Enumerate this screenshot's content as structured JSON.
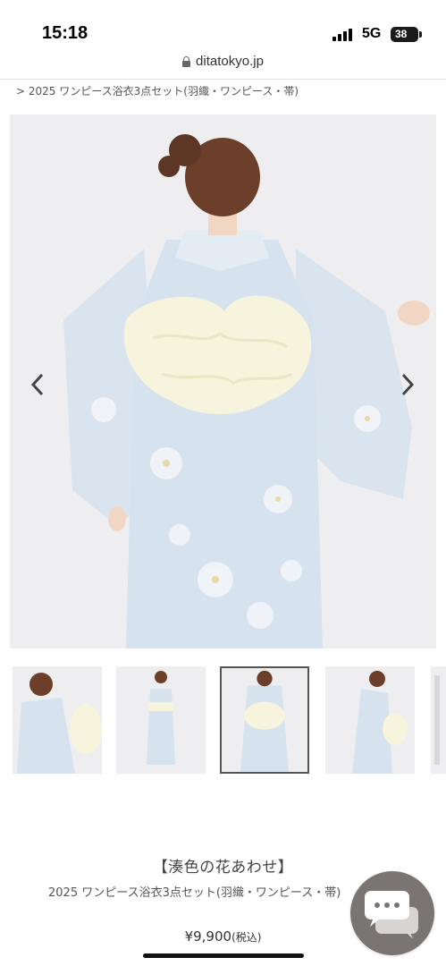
{
  "status_bar": {
    "time": "15:18",
    "network": "5G",
    "battery": "38"
  },
  "browser": {
    "url": "ditatokyo.jp",
    "lock_icon": "lock-icon"
  },
  "breadcrumb": {
    "text": "> 2025 ワンピース浴衣3点セット(羽織・ワンピース・帯)"
  },
  "gallery": {
    "prev_icon": "chevron-left-icon",
    "next_icon": "chevron-right-icon",
    "selected_index": 2,
    "colors": {
      "background": "#eeeef0",
      "kimono": "#d6e2ee",
      "obi": "#f6f4dc",
      "hair": "#6b3f2a",
      "skin": "#f2d6c4"
    }
  },
  "product": {
    "series": "【湊色の花あわせ】",
    "name": "2025 ワンピース浴衣3点セット(羽織・ワンピース・帯)",
    "price": "¥9,900",
    "tax_note": "(税込)"
  },
  "chat": {
    "icon": "chat-bubble-icon"
  }
}
